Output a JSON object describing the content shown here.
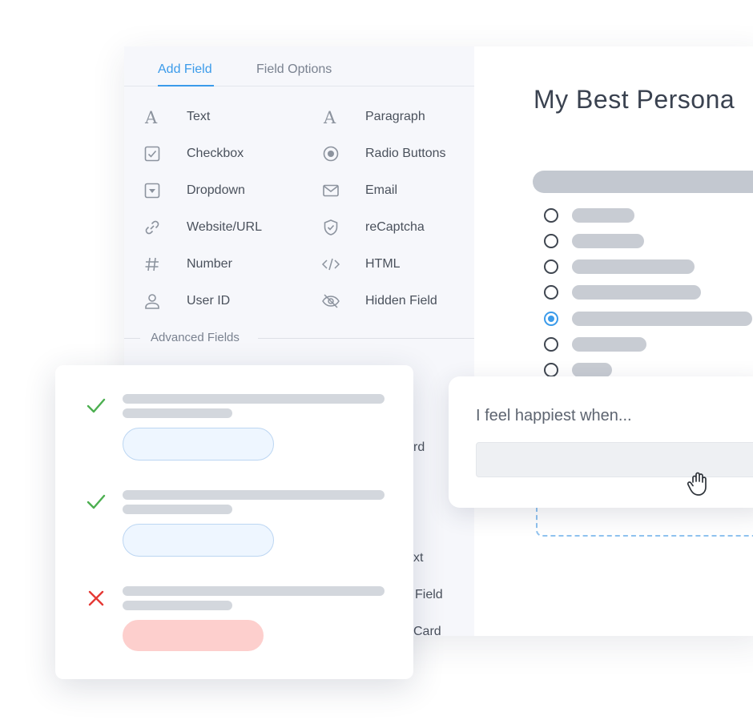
{
  "builder": {
    "tabs": [
      {
        "label": "Add Field",
        "active": true
      },
      {
        "label": "Field Options",
        "active": false
      }
    ],
    "fields_left": [
      {
        "icon": "text-icon",
        "label": "Text"
      },
      {
        "icon": "checkbox-icon",
        "label": "Checkbox"
      },
      {
        "icon": "dropdown-icon",
        "label": "Dropdown"
      },
      {
        "icon": "link-icon",
        "label": "Website/URL"
      },
      {
        "icon": "hash-icon",
        "label": "Number"
      },
      {
        "icon": "user-icon",
        "label": "User ID"
      }
    ],
    "fields_right": [
      {
        "icon": "paragraph-icon",
        "label": "Paragraph"
      },
      {
        "icon": "radio-icon",
        "label": "Radio Buttons"
      },
      {
        "icon": "email-icon",
        "label": "Email"
      },
      {
        "icon": "shield-check-icon",
        "label": "reCaptcha"
      },
      {
        "icon": "code-icon",
        "label": "HTML"
      },
      {
        "icon": "eye-off-icon",
        "label": "Hidden Field"
      }
    ],
    "advanced_label": "Advanced Fields",
    "partial_labels": [
      "rd",
      "xt",
      "Field",
      "Card"
    ]
  },
  "preview": {
    "title": "My Best Persona",
    "options_selected_index": 4
  },
  "entry_card": {
    "question": "I feel happiest when..."
  },
  "validation": {
    "rows": [
      {
        "status": "valid",
        "mark_icon": "check-icon",
        "color": "#4caf50"
      },
      {
        "status": "valid",
        "mark_icon": "check-icon",
        "color": "#4caf50"
      },
      {
        "status": "invalid",
        "mark_icon": "cross-icon",
        "color": "#e53935"
      }
    ]
  },
  "colors": {
    "accent": "#3b9bea",
    "valid": "#4caf50",
    "invalid": "#e53935",
    "invalid_fill": "#fdcfcd"
  }
}
